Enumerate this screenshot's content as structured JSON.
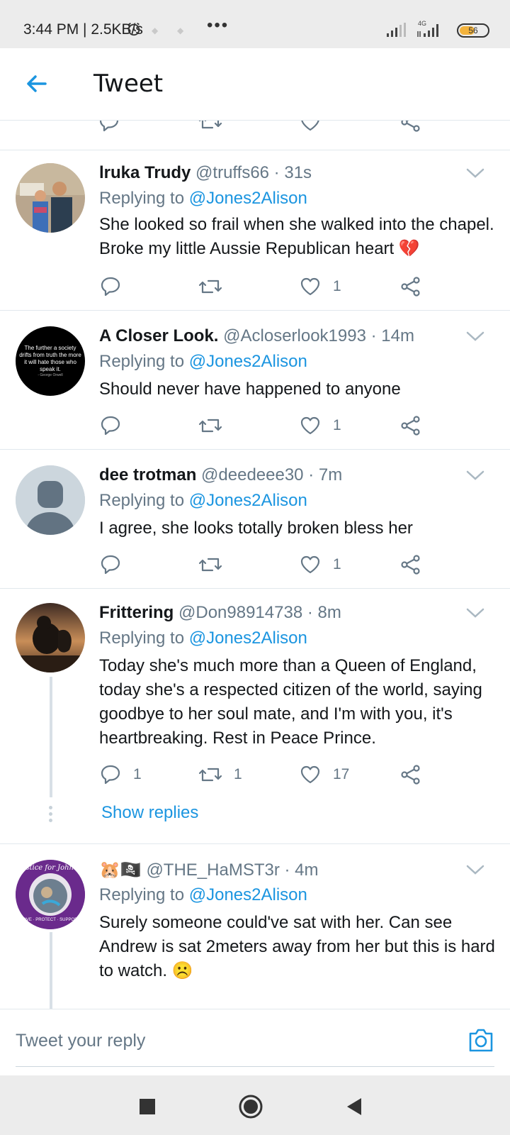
{
  "status_bar": {
    "time_speed": "3:44 PM | 2.5KB/s",
    "more": "•••",
    "network_type": "4G",
    "battery_level": "56",
    "battery_fraction": 0.56,
    "battery_color": "#f3b33d"
  },
  "header": {
    "title": "Tweet"
  },
  "colors": {
    "link": "#1b95e0",
    "secondary_text": "#657786",
    "divider": "#e1e8ed"
  },
  "tweets": [
    {
      "name": "lruka Trudy",
      "handle_time": "@truffs66 · 31s",
      "replying_prefix": "Replying to ",
      "replying_handle": "@Jones2Alison",
      "body": "She looked so frail when she walked into the chapel. Broke my little Aussie Republican heart 💔",
      "counts": {
        "reply": "",
        "retweet": "",
        "like": "1"
      }
    },
    {
      "name": "A Closer Look.",
      "handle_time": "@Acloserlook1993 · 14m",
      "replying_prefix": "Replying to ",
      "replying_handle": "@Jones2Alison",
      "body": "Should never have happened to anyone",
      "avatar_text": "The further a society drifts from truth the more it will hate those who speak it.",
      "avatar_attribution": "- George Orwell",
      "counts": {
        "reply": "",
        "retweet": "",
        "like": "1"
      }
    },
    {
      "name": "dee trotman",
      "handle_time": "@deedeee30 · 7m",
      "replying_prefix": "Replying to ",
      "replying_handle": "@Jones2Alison",
      "body": "I agree, she looks totally broken bless her",
      "counts": {
        "reply": "",
        "retweet": "",
        "like": "1"
      }
    },
    {
      "name": "Frittering",
      "handle_time": "@Don98914738 · 8m",
      "replying_prefix": "Replying to ",
      "replying_handle": "@Jones2Alison",
      "body": "Today she's much more than a Queen of England, today she's a respected citizen of the world, saying goodbye to her soul mate, and I'm with you, it's heartbreaking. Rest in Peace Prince.",
      "counts": {
        "reply": "1",
        "retweet": "1",
        "like": "17"
      },
      "show_replies": "Show replies"
    },
    {
      "name": "🐹🏴‍☠️",
      "handle_time": "@THE_HaMST3r · 4m",
      "replying_prefix": "Replying to ",
      "replying_handle": "@Jones2Alison",
      "body": "Surely someone could've sat with her. Can see Andrew is sat 2meters away from her but this is hard to watch. ☹️",
      "avatar_text": "Justice for Johnny",
      "avatar_text_bottom": "LOVE · PROTECT · SUPPORT"
    }
  ],
  "composer": {
    "placeholder": "Tweet your reply"
  }
}
